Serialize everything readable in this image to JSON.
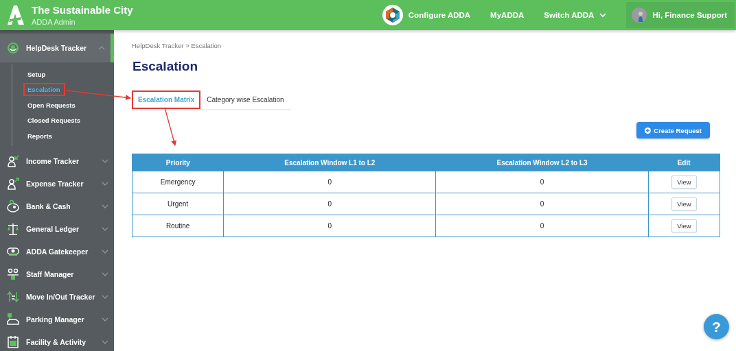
{
  "header": {
    "title": "The Sustainable City",
    "subtitle": "ADDA Admin",
    "nav": [
      {
        "label": "Configure ADDA",
        "kind": "logo"
      },
      {
        "label": "MyADDA",
        "kind": "plain"
      },
      {
        "label": "Switch ADDA",
        "kind": "dropdown"
      }
    ],
    "user": "Hi, Finance Support"
  },
  "sidebar": {
    "items": [
      {
        "label": "HelpDesk Tracker",
        "expanded": true,
        "selected": true,
        "children": [
          {
            "label": "Setup",
            "selected": false,
            "highlighted": false
          },
          {
            "label": "Escalation",
            "selected": true,
            "highlighted": true
          },
          {
            "label": "Open Requests",
            "selected": false,
            "highlighted": false
          },
          {
            "label": "Closed Requests",
            "selected": false,
            "highlighted": false
          },
          {
            "label": "Reports",
            "selected": false,
            "highlighted": false
          }
        ]
      },
      {
        "label": "Income Tracker",
        "expanded": false,
        "selected": false
      },
      {
        "label": "Expense Tracker",
        "expanded": false,
        "selected": false
      },
      {
        "label": "Bank & Cash",
        "expanded": false,
        "selected": false
      },
      {
        "label": "General Ledger",
        "expanded": false,
        "selected": false
      },
      {
        "label": "ADDA Gatekeeper",
        "expanded": false,
        "selected": false
      },
      {
        "label": "Staff Manager",
        "expanded": false,
        "selected": false
      },
      {
        "label": "Move In/Out Tracker",
        "expanded": false,
        "selected": false
      },
      {
        "label": "Parking Manager",
        "expanded": false,
        "selected": false
      },
      {
        "label": "Facility & Activity",
        "expanded": false,
        "selected": false
      }
    ]
  },
  "breadcrumb": "HelpDesk Tracker > Escalation",
  "title": "Escalation",
  "tabs": [
    {
      "label": "Escalation Matrix",
      "selected": true,
      "highlighted": true
    },
    {
      "label": "Category wise Escalation",
      "selected": false,
      "highlighted": false
    }
  ],
  "create_button": "Create Request",
  "table": {
    "columns": [
      "Priority",
      "Escalation Window L1 to L2",
      "Escalation Window L2 to L3",
      "Edit"
    ],
    "rows": [
      {
        "priority": "Emergency",
        "l1_l2": "0",
        "l2_l3": "0",
        "edit": "View"
      },
      {
        "priority": "Urgent",
        "l1_l2": "0",
        "l2_l3": "0",
        "edit": "View"
      },
      {
        "priority": "Routine",
        "l1_l2": "0",
        "l2_l3": "0",
        "edit": "View"
      }
    ]
  },
  "help_button": "?"
}
